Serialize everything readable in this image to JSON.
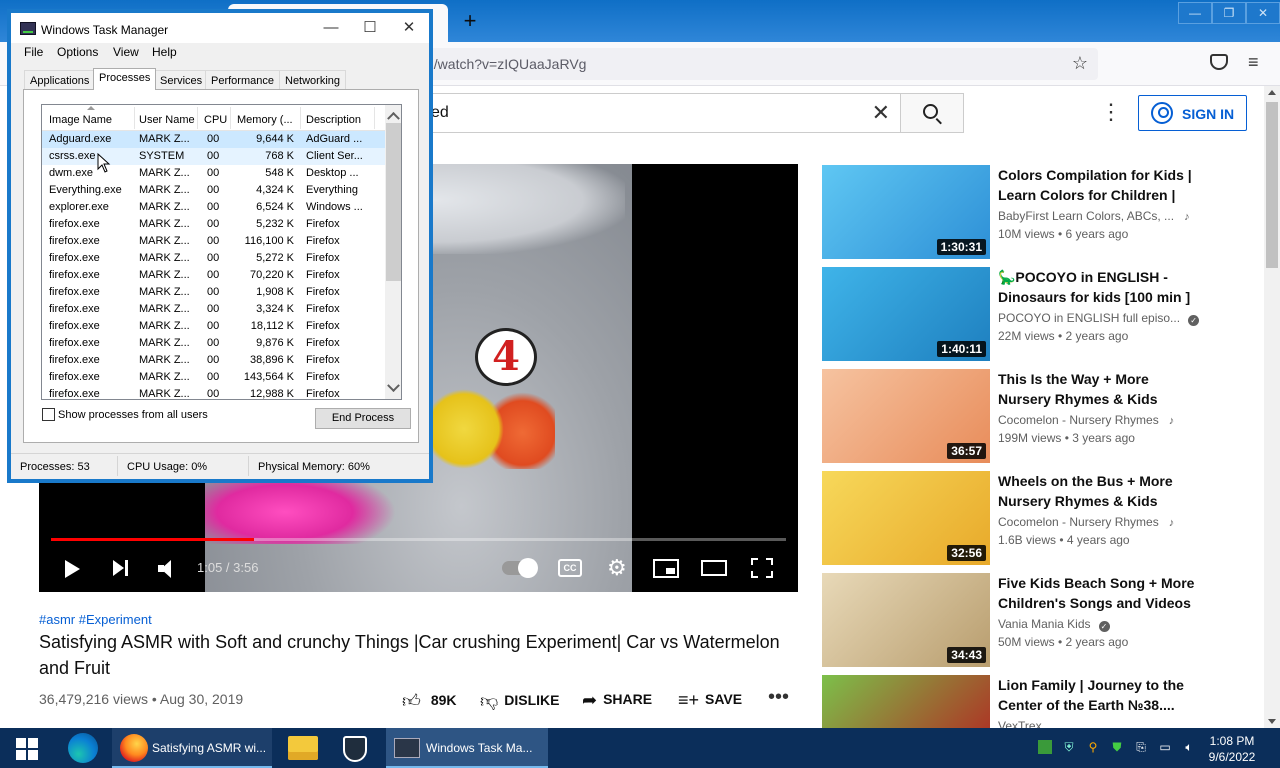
{
  "firefox": {
    "url": "n/watch?v=zIQUaaJaRVg",
    "new_tab": "+",
    "controls": {
      "minimize": "—",
      "restore": "❐",
      "close": "✕"
    },
    "menu_icon": "≡",
    "star_icon": "☆"
  },
  "youtube": {
    "search_value": "ed",
    "clear": "✕",
    "more": "⋮",
    "sign_in": "SIGN IN",
    "player": {
      "bubble_number": "4",
      "time": "1:05 / 3:56",
      "progress_fraction": 0.276,
      "cc": "CC"
    },
    "tags": "#asmr #Experiment",
    "title": "Satisfying ASMR with Soft and crunchy Things |Car crushing Experiment| Car vs Watermelon and Fruit",
    "meta": "36,479,216 views • Aug 30, 2019",
    "actions": {
      "likes": "89K",
      "dislike": "DISLIKE",
      "share": "SHARE",
      "save": "SAVE"
    },
    "recommendations": [
      {
        "title": "Colors Compilation for Kids | Learn Colors for Children | Col...",
        "channel": "BabyFirst Learn Colors, ABCs, ...",
        "views": "10M views • 6 years ago",
        "duration": "1:30:31"
      },
      {
        "title": "🦕POCOYO in ENGLISH - Dinosaurs for kids [100 min ] |...",
        "channel": "POCOYO in ENGLISH full episo...",
        "views": "22M views • 2 years ago",
        "duration": "1:40:11"
      },
      {
        "title": "This Is the Way + More Nursery Rhymes & Kids Songs -...",
        "channel": "Cocomelon - Nursery Rhymes",
        "views": "199M views • 3 years ago",
        "duration": "36:57"
      },
      {
        "title": "Wheels on the Bus + More Nursery Rhymes & Kids Songs...",
        "channel": "Cocomelon - Nursery Rhymes",
        "views": "1.6B views • 4 years ago",
        "duration": "32:56"
      },
      {
        "title": "Five Kids Beach Song + More Children's Songs and Videos",
        "channel": "Vania Mania Kids",
        "views": "50M views • 2 years ago",
        "duration": "34:43"
      },
      {
        "title": "Lion Family | Journey to the Center of the Earth №38....",
        "channel": "VexTrex",
        "views": "",
        "duration": ""
      }
    ]
  },
  "taskmgr": {
    "title": "Windows Task Manager",
    "menu": [
      "File",
      "Options",
      "View",
      "Help"
    ],
    "tabs": [
      "Applications",
      "Processes",
      "Services",
      "Performance",
      "Networking"
    ],
    "active_tab": "Processes",
    "columns": [
      "Image Name",
      "User Name",
      "CPU",
      "Memory (...",
      "Description"
    ],
    "rows": [
      [
        "Adguard.exe",
        "MARK Z...",
        "00",
        "9,644 K",
        "AdGuard ..."
      ],
      [
        "csrss.exe",
        "SYSTEM",
        "00",
        "768 K",
        "Client Ser..."
      ],
      [
        "dwm.exe",
        "MARK Z...",
        "00",
        "548 K",
        "Desktop ..."
      ],
      [
        "Everything.exe",
        "MARK Z...",
        "00",
        "4,324 K",
        "Everything"
      ],
      [
        "explorer.exe",
        "MARK Z...",
        "00",
        "6,524 K",
        "Windows ..."
      ],
      [
        "firefox.exe",
        "MARK Z...",
        "00",
        "5,232 K",
        "Firefox"
      ],
      [
        "firefox.exe",
        "MARK Z...",
        "00",
        "116,100 K",
        "Firefox"
      ],
      [
        "firefox.exe",
        "MARK Z...",
        "00",
        "5,272 K",
        "Firefox"
      ],
      [
        "firefox.exe",
        "MARK Z...",
        "00",
        "70,220 K",
        "Firefox"
      ],
      [
        "firefox.exe",
        "MARK Z...",
        "00",
        "1,908 K",
        "Firefox"
      ],
      [
        "firefox.exe",
        "MARK Z...",
        "00",
        "3,324 K",
        "Firefox"
      ],
      [
        "firefox.exe",
        "MARK Z...",
        "00",
        "18,112 K",
        "Firefox"
      ],
      [
        "firefox.exe",
        "MARK Z...",
        "00",
        "9,876 K",
        "Firefox"
      ],
      [
        "firefox.exe",
        "MARK Z...",
        "00",
        "38,896 K",
        "Firefox"
      ],
      [
        "firefox.exe",
        "MARK Z...",
        "00",
        "143,564 K",
        "Firefox"
      ],
      [
        "firefox.exe",
        "MARK Z...",
        "00",
        "12,988 K",
        "Firefox"
      ]
    ],
    "show_all": "Show processes from all users",
    "end_process": "End Process",
    "status": {
      "processes": "Processes: 53",
      "cpu": "CPU Usage: 0%",
      "memory": "Physical Memory: 60%"
    }
  },
  "taskbar": {
    "firefox_label": "Satisfying ASMR wi...",
    "taskmgr_label": "Windows Task Ma...",
    "time": "1:08 PM",
    "date": "9/6/2022"
  }
}
